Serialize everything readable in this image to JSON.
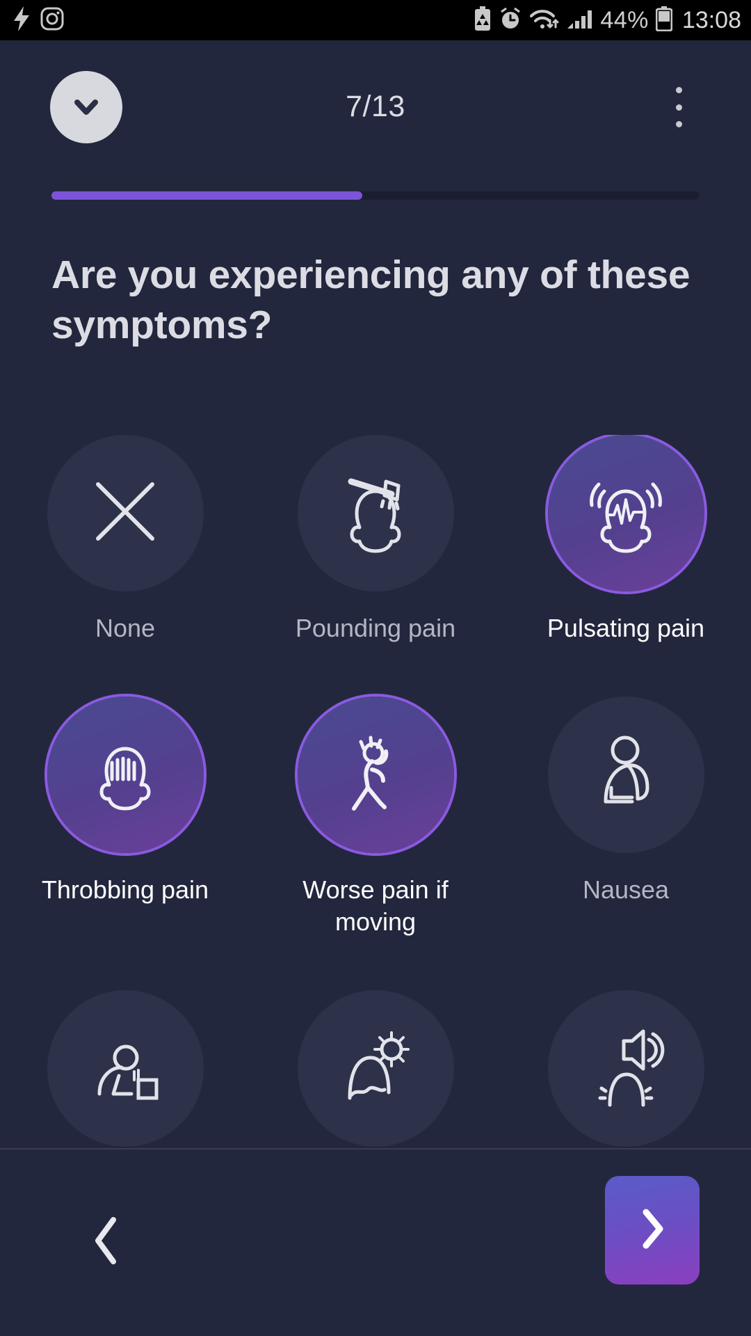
{
  "statusbar": {
    "left_icons": [
      "flash-icon",
      "instagram-icon"
    ],
    "right_icons": [
      "battery-saver-icon",
      "alarm-icon",
      "wifi-icon",
      "signal-icon",
      "battery-icon"
    ],
    "battery_percent": "44%",
    "time": "13:08"
  },
  "header": {
    "collapse_icon": "chevron-down-icon",
    "step_counter": "7/13",
    "menu_icon": "kebab-menu-icon",
    "progress_percent": 48,
    "progress_color": "#7c54d8",
    "progress_track_color": "#1b1e30"
  },
  "question": {
    "title": "Are you experiencing any of these symptoms?"
  },
  "options": [
    [
      {
        "label": "None",
        "icon": "cross-icon",
        "selected": false
      },
      {
        "label": "Pounding pain",
        "icon": "hammer-head-icon",
        "selected": false
      },
      {
        "label": "Pulsating pain",
        "icon": "head-pulse-waves-icon",
        "selected": true
      }
    ],
    [
      {
        "label": "Throbbing pain",
        "icon": "head-bars-icon",
        "selected": true
      },
      {
        "label": "Worse pain if moving",
        "icon": "walking-person-headache-icon",
        "selected": true
      },
      {
        "label": "Nausea",
        "icon": "person-nausea-icon",
        "selected": false
      }
    ],
    [
      {
        "label": "",
        "icon": "person-vomiting-icon",
        "selected": false
      },
      {
        "label": "",
        "icon": "head-sun-light-sensitivity-icon",
        "selected": false
      },
      {
        "label": "",
        "icon": "head-speaker-sound-sensitivity-icon",
        "selected": false
      }
    ]
  ],
  "bottombar": {
    "back_icon": "chevron-left-icon",
    "next_icon": "chevron-right-icon",
    "next_gradient_from": "#5a5cc9",
    "next_gradient_to": "#8b3fbf"
  },
  "colors": {
    "background": "#23273d",
    "bubble": "#2d3149",
    "selected_ring": "#8a5ae0",
    "text": "#dcdde4",
    "muted_text": "#b4b6c4"
  }
}
